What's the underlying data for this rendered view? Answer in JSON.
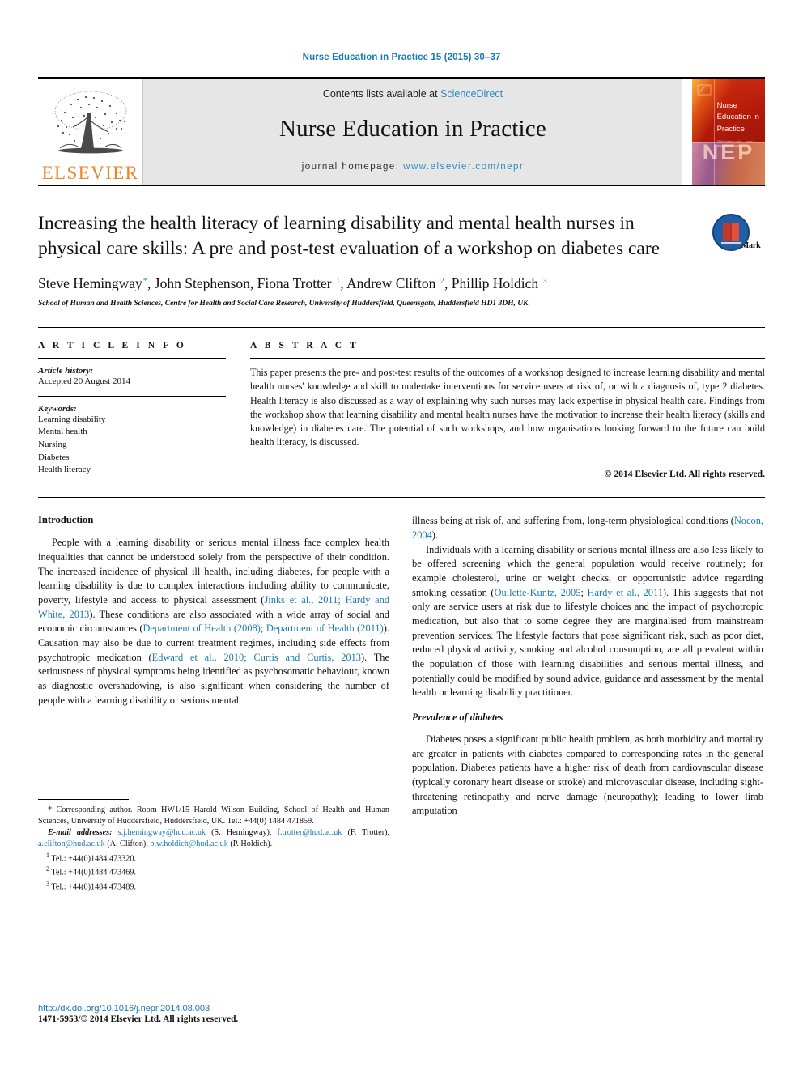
{
  "running_head": "Nurse Education in Practice 15 (2015) 30–37",
  "masthead": {
    "contents_prefix": "Contents lists available at ",
    "sciencedirect": "ScienceDirect",
    "journal_title": "Nurse Education in Practice",
    "homepage_prefix": "journal homepage: ",
    "homepage_url": "www.elsevier.com/nepr",
    "publisher_logo_text": "ELSEVIER",
    "cover": {
      "title": "Nurse Education in Practice",
      "watermark": "NEP",
      "small_text": "Official journal of the ... nurse education association"
    },
    "colors": {
      "link": "#2a8bc4",
      "panel_bg": "#e6e6e6",
      "elsevier_orange": "#E8862B",
      "cover_red": "#b11a0a"
    }
  },
  "article": {
    "title": "Increasing the health literacy of learning disability and mental health nurses in physical care skills: A pre and post-test evaluation of a workshop on diabetes care",
    "crossmark_label": "CrossMark",
    "authors": [
      {
        "name": "Steve Hemingway",
        "marker": "*"
      },
      {
        "name": "John Stephenson",
        "marker": ""
      },
      {
        "name": "Fiona Trotter",
        "marker": "1"
      },
      {
        "name": "Andrew Clifton",
        "marker": "2"
      },
      {
        "name": "Phillip Holdich",
        "marker": "3"
      }
    ],
    "affiliation": "School of Human and Health Sciences, Centre for Health and Social Care Research, University of Huddersfield, Queensgate, Huddersfield HD1 3DH, UK"
  },
  "article_info": {
    "heading": "A R T I C L E   I N F O",
    "history_label": "Article history:",
    "history_value": "Accepted 20 August 2014",
    "keywords_label": "Keywords:",
    "keywords": [
      "Learning disability",
      "Mental health",
      "Nursing",
      "Diabetes",
      "Health literacy"
    ]
  },
  "abstract": {
    "heading": "A B S T R A C T",
    "text": "This paper presents the pre- and post-test results of the outcomes of a workshop designed to increase learning disability and mental health nurses' knowledge and skill to undertake interventions for service users at risk of, or with a diagnosis of, type 2 diabetes. Health literacy is also discussed as a way of explaining why such nurses may lack expertise in physical health care. Findings from the workshop show that learning disability and mental health nurses have the motivation to increase their health literacy (skills and knowledge) in diabetes care. The potential of such workshops, and how organisations looking forward to the future can build health literacy, is discussed.",
    "copyright": "© 2014 Elsevier Ltd. All rights reserved."
  },
  "body": {
    "intro_heading": "Introduction",
    "left_p1_a": "People with a learning disability or serious mental illness face complex health inequalities that cannot be understood solely from the perspective of their condition. The increased incidence of physical ill health, including diabetes, for people with a learning disability is due to complex interactions including ability to communicate, poverty, lifestyle and access to physical assessment (",
    "left_cite1": "Jinks et al., 2011; Hardy and White, 2013",
    "left_p1_b": "). These conditions are also associated with a wide array of social and economic circumstances (",
    "left_cite2": "Department of Health (2008)",
    "left_p1_c": "; ",
    "left_cite3": "Department of Health (2011)",
    "left_p1_d": "). Causation may also be due to current treatment regimes, including side effects from psychotropic medication (",
    "left_cite4": "Edward et al., 2010; Curtis and Curtis, 2013",
    "left_p1_e": "). The seriousness of physical symptoms being identified as psychosomatic behaviour, known as diagnostic overshadowing, is also significant when considering the number of people with a learning disability or serious mental",
    "right_p1_a": "illness being at risk of, and suffering from, long-term physiological conditions (",
    "right_cite1": "Nocon, 2004",
    "right_p1_b": ").",
    "right_p2_a": "Individuals with a learning disability or serious mental illness are also less likely to be offered screening which the general population would receive routinely; for example cholesterol, urine or weight checks, or opportunistic advice regarding smoking cessation (",
    "right_cite2": "Oullette-Kuntz, 2005",
    "right_p2_b": "; ",
    "right_cite3": "Hardy et al., 2011",
    "right_p2_c": "). This suggests that not only are service users at risk due to lifestyle choices and the impact of psychotropic medication, but also that to some degree they are marginalised from mainstream prevention services. The lifestyle factors that pose significant risk, such as poor diet, reduced physical activity, smoking and alcohol consumption, are all prevalent within the population of those with learning disabilities and serious mental illness, and potentially could be modified by sound advice, guidance and assessment by the mental health or learning disability practitioner.",
    "prevalence_heading": "Prevalence of diabetes",
    "right_p3": "Diabetes poses a significant public health problem, as both morbidity and mortality are greater in patients with diabetes compared to corresponding rates in the general population. Diabetes patients have a higher risk of death from cardiovascular disease (typically coronary heart disease or stroke) and microvascular disease, including sight-threatening retinopathy and nerve damage (neuropathy); leading to lower limb amputation"
  },
  "footnotes": {
    "corresponding": "* Corresponding author. Room HW1/15 Harold Wilson Building, School of Health and Human Sciences, University of Huddersfield, Huddersfield, UK. Tel.: +44(0) 1484 471859.",
    "email_label": "E-mail addresses:",
    "emails": [
      {
        "address": "s.j.hemingway@hud.ac.uk",
        "person": "(S. Hemingway)"
      },
      {
        "address": "f.trotter@hud.ac.uk",
        "person": "(F. Trotter)"
      },
      {
        "address": "a.clifton@hud.ac.uk",
        "person": "(A. Clifton)"
      },
      {
        "address": "p.w.holdich@hud.ac.uk",
        "person": "(P. Holdich)"
      }
    ],
    "tels": [
      {
        "marker": "1",
        "value": "Tel.: +44(0)1484 473320."
      },
      {
        "marker": "2",
        "value": "Tel.: +44(0)1484 473469."
      },
      {
        "marker": "3",
        "value": "Tel.: +44(0)1484 473489."
      }
    ]
  },
  "doi": {
    "url": "http://dx.doi.org/10.1016/j.nepr.2014.08.003",
    "issn_copyright": "1471-5953/© 2014 Elsevier Ltd. All rights reserved."
  }
}
